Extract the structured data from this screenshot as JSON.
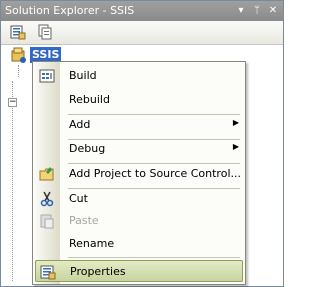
{
  "window": {
    "title": "Solution Explorer - SSIS",
    "buttons": [
      "dropdown-icon",
      "pin-icon",
      "close-icon"
    ]
  },
  "toolbar": {
    "icons": [
      "properties-icon",
      "show-all-files-icon"
    ]
  },
  "tree": {
    "root_label": "SSIS"
  },
  "context_menu": {
    "items": [
      {
        "label": "Build",
        "icon": "build-icon"
      },
      {
        "label": "Rebuild",
        "icon": ""
      },
      {
        "label": "Add",
        "submenu": true
      },
      {
        "label": "Debug",
        "submenu": true
      },
      {
        "label": "Add Project to Source Control...",
        "icon": "source-control-icon"
      },
      {
        "label": "Cut",
        "icon": "scissors-icon"
      },
      {
        "label": "Paste",
        "icon": "paste-icon",
        "disabled": true
      },
      {
        "label": "Rename",
        "icon": ""
      },
      {
        "label": "Properties",
        "icon": "properties-icon",
        "selected": true
      }
    ]
  },
  "colors": {
    "titlebar": "#8e8e8e",
    "selection": "#3169c6",
    "menu_highlight": "#c7d4a0"
  }
}
